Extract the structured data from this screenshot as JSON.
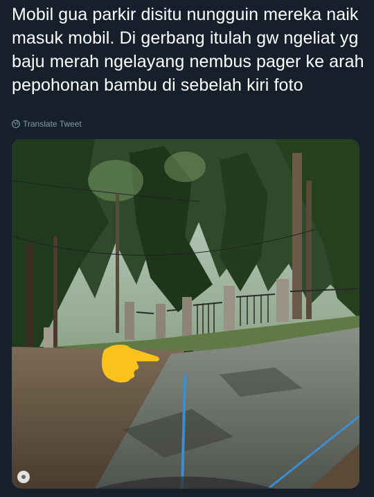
{
  "tweet": {
    "text": "Mobil gua parkir disitu nungguin mereka naik masuk mobil. Di gerbang itulah gw ngeliat yg baju merah ngelayang nembus pager ke arah pepohonan bambu di sebelah kiri foto",
    "translate_label": "Translate Tweet"
  },
  "colors": {
    "background": "#15202b",
    "text": "#ffffff",
    "secondary_text": "#8899a6",
    "hand_emoji": "#fcc21b",
    "road_line": "#3b8ed1"
  },
  "icons": {
    "translate": "globe-icon",
    "emoji": "pointing-right-hand-icon",
    "streetview": "pegman-icon"
  }
}
